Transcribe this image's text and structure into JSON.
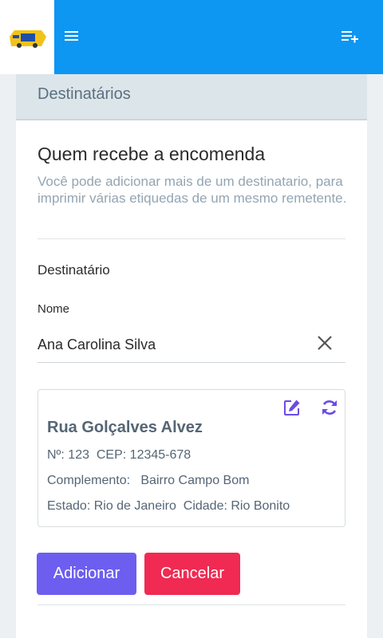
{
  "header": {
    "logo": "truck-logo-icon",
    "menu_icon": "hamburger-menu-icon",
    "action_icon": "playlist-add-icon"
  },
  "card": {
    "header_title": "Destinatários",
    "title": "Quem recebe a encomenda",
    "description": "Você pode adicionar mais de um destinatario, para imprimir várias etiquedas de um mesmo remetente."
  },
  "recipient": {
    "section_label": "Destinatário",
    "name_label": "Nome",
    "name_value": "Ana Carolina Silva",
    "clear_icon": "close-icon"
  },
  "address": {
    "street": "Rua Golçalves Alvez",
    "number_cep": "Nº: 123  CEP: 12345-678",
    "complement": "Complemento:   Bairro Campo Bom",
    "state_city": "Estado: Rio de Janeiro  Cidade: Rio Bonito",
    "edit_icon": "edit-icon",
    "refresh_icon": "refresh-icon"
  },
  "actions": {
    "add_label": "Adicionar",
    "cancel_label": "Cancelar"
  },
  "colors": {
    "topbar": "#0d96f2",
    "card_header": "#dce5e9",
    "add_button": "#6d5ef0",
    "cancel_button": "#f02a52",
    "icon_accent": "#6a4ce8"
  }
}
